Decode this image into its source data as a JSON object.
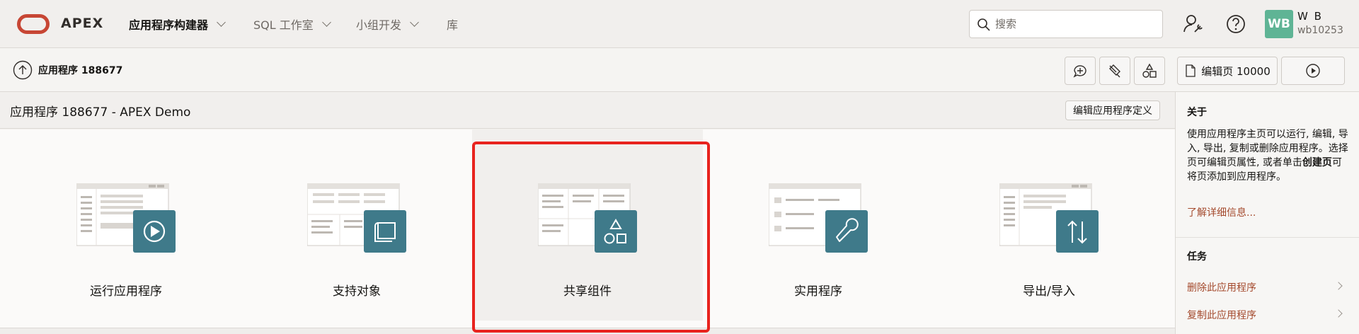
{
  "header": {
    "brand": "APEX",
    "nav": [
      {
        "label": "应用程序构建器",
        "active": true
      },
      {
        "label": "SQL 工作室",
        "active": false
      },
      {
        "label": "小组开发",
        "active": false
      },
      {
        "label": "库",
        "active": false
      }
    ],
    "search_placeholder": "搜索",
    "avatar_initials": "WB",
    "user_name": "W B",
    "user_id": "wb10253"
  },
  "subbar": {
    "app_crumb": "应用程序 188677",
    "edit_page_label": "编辑页 10000"
  },
  "titlebar": {
    "title": "应用程序 188677 - APEX Demo",
    "edit_definition": "编辑应用程序定义"
  },
  "tiles": [
    {
      "label": "运行应用程序",
      "icon": "play-icon"
    },
    {
      "label": "支持对象",
      "icon": "scroll-icon"
    },
    {
      "label": "共享组件",
      "icon": "shapes-icon"
    },
    {
      "label": "实用程序",
      "icon": "wrench-icon"
    },
    {
      "label": "导出/导入",
      "icon": "up-down-arrows-icon"
    }
  ],
  "sidebar": {
    "about_heading": "关于",
    "about_text_1": "使用应用程序主页可以运行, 编辑, 导入, 导出, 复制或删除应用程序。选择页可编辑页属性, 或者单击",
    "about_text_bold": "创建页",
    "about_text_2": "可将页添加到应用程序。",
    "learn_more": "了解详细信息...",
    "tasks_heading": "任务",
    "tasks": [
      "删除此应用程序",
      "复制此应用程序"
    ]
  },
  "colors": {
    "accent": "#c74634",
    "tile_icon": "#3f7a8a",
    "highlight": "#e8231e",
    "link": "#a44a2d"
  }
}
